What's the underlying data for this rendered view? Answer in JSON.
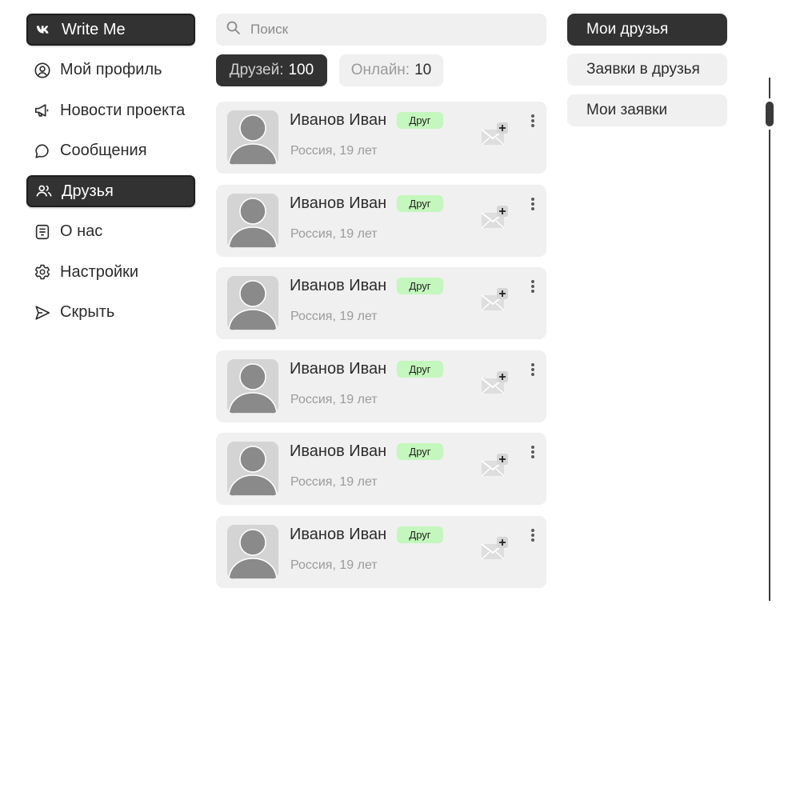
{
  "sidebar": {
    "items": [
      {
        "label": "Write Me",
        "icon": "vk-logo-icon",
        "active": true
      },
      {
        "label": "Мой профиль",
        "icon": "profile-icon"
      },
      {
        "label": "Новости проекта",
        "icon": "megaphone-icon"
      },
      {
        "label": "Сообщения",
        "icon": "message-bubble-icon"
      },
      {
        "label": "Друзья",
        "icon": "friends-icon",
        "active": true
      },
      {
        "label": "О нас",
        "icon": "about-icon"
      },
      {
        "label": "Настройки",
        "icon": "gear-icon"
      },
      {
        "label": "Скрыть",
        "icon": "send-arrow-icon"
      }
    ]
  },
  "search": {
    "placeholder": "Поиск",
    "value": ""
  },
  "counters": {
    "friends": {
      "label": "Друзей:",
      "value": "100"
    },
    "online": {
      "label": "Онлайн:",
      "value": "10"
    }
  },
  "friends": [
    {
      "name": "Иванов Иван",
      "badge": "Друг",
      "subtitle": "Россия, 19 лет"
    },
    {
      "name": "Иванов Иван",
      "badge": "Друг",
      "subtitle": "Россия, 19 лет"
    },
    {
      "name": "Иванов Иван",
      "badge": "Друг",
      "subtitle": "Россия, 19 лет"
    },
    {
      "name": "Иванов Иван",
      "badge": "Друг",
      "subtitle": "Россия, 19 лет"
    },
    {
      "name": "Иванов Иван",
      "badge": "Друг",
      "subtitle": "Россия, 19 лет"
    },
    {
      "name": "Иванов Иван",
      "badge": "Друг",
      "subtitle": "Россия, 19 лет"
    }
  ],
  "tabs": [
    {
      "label": "Мои друзья",
      "active": true
    },
    {
      "label": "Заявки в друзья"
    },
    {
      "label": "Мои заявки"
    }
  ],
  "colors": {
    "dark": "#323232",
    "light": "#f0f0f0",
    "badge": "#c4f7bd",
    "muted": "#9b9b9b"
  }
}
